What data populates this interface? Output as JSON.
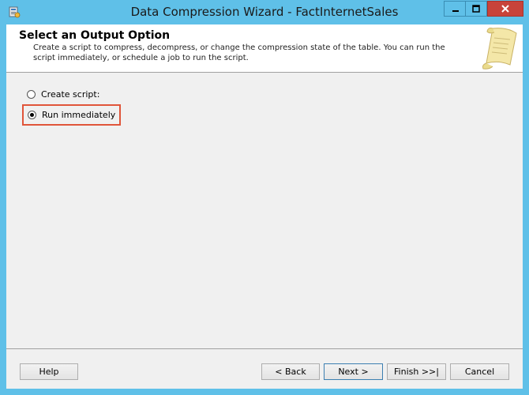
{
  "window": {
    "title": "Data Compression Wizard - FactInternetSales",
    "app_icon": "wizard-app-icon",
    "controls": [
      "minimize",
      "maximize",
      "close"
    ]
  },
  "header": {
    "title": "Select an Output Option",
    "description": "Create a script to compress, decompress, or change the compression state of the table. You can run the script immediately, or schedule a job to run the script.",
    "art_icon": "scroll-icon"
  },
  "options": [
    {
      "label": "Create script:",
      "selected": false
    },
    {
      "label": "Run immediately",
      "selected": true,
      "highlighted": true
    }
  ],
  "buttons": {
    "help": "Help",
    "back": "< Back",
    "next": "Next >",
    "finish": "Finish >>|",
    "cancel": "Cancel"
  },
  "colors": {
    "titlebar": "#5fc0e8",
    "close_button": "#c8433a",
    "highlight_border": "#e0553a",
    "content_bg": "#f0f0f0"
  }
}
